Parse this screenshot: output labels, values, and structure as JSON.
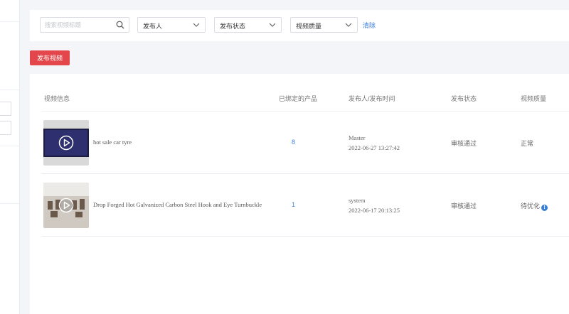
{
  "filters": {
    "search_placeholder": "搜索视频标题",
    "publisher": "发布人",
    "status": "发布状态",
    "quality": "视频质量",
    "clear": "清除"
  },
  "actions": {
    "publish": "发布视频"
  },
  "table": {
    "headers": {
      "info": "视频信息",
      "bound": "已绑定的产品",
      "publisher_time": "发布人/发布时间",
      "status": "发布状态",
      "quality": "视频质量"
    },
    "rows": [
      {
        "title": "hot sale car tyre",
        "bound_count": "8",
        "publisher": "Master",
        "time": "2022-06-27 13:27:42",
        "status": "审核通过",
        "quality": "正常",
        "quality_info": false
      },
      {
        "title": "Drop Forged Hot Galvanized Carbon Steel Hook and Eye Turnbuckle",
        "bound_count": "1",
        "publisher": "system",
        "time": "2022-06-17 20:13:25",
        "status": "审核通过",
        "quality": "待优化",
        "quality_info": true
      }
    ]
  },
  "colors": {
    "accent": "#3a7fd6",
    "danger": "#e4474b"
  }
}
